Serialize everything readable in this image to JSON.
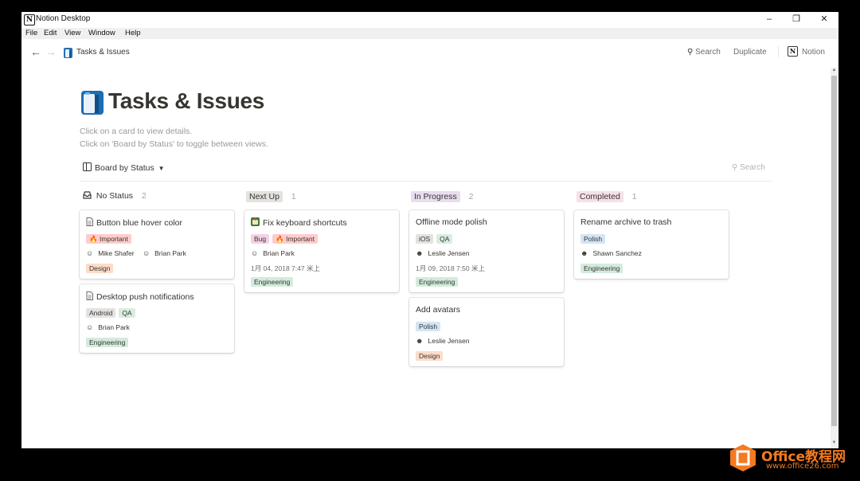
{
  "window": {
    "app_title": "Notion Desktop",
    "menus": [
      "File",
      "Edit",
      "View",
      "Window",
      "Help"
    ]
  },
  "topbar": {
    "breadcrumb": "Tasks & Issues",
    "actions": {
      "search": "Search",
      "duplicate": "Duplicate",
      "notion": "Notion"
    }
  },
  "page": {
    "title": "Tasks & Issues",
    "description": [
      "Click on a card to view details.",
      "Click on 'Board by Status' to toggle between views."
    ],
    "view_switcher": "Board by Status",
    "board_search": "Search"
  },
  "board": {
    "columns": [
      {
        "name": "No Status",
        "count": "2",
        "cards": [
          {
            "title": "Button blue hover color",
            "tags1": [
              {
                "label": "Important",
                "color": "#ffcccc",
                "emoji": "🔥"
              }
            ],
            "people": [
              "Mike Shafer",
              "Brian Park"
            ],
            "tags2": [
              {
                "label": "Design",
                "color": "#fcdcc8"
              }
            ]
          },
          {
            "title": "Desktop push notifications",
            "tags1": [
              {
                "label": "Android",
                "color": "#e3e2e0"
              },
              {
                "label": "QA",
                "color": "#d9ede0"
              }
            ],
            "people": [
              "Brian Park"
            ],
            "tags2": [
              {
                "label": "Engineering",
                "color": "#d3ebdd"
              }
            ]
          }
        ]
      },
      {
        "name": "Next Up",
        "count": "1",
        "cards": [
          {
            "title": "Fix keyboard shortcuts",
            "tags1": [
              {
                "label": "Bug",
                "color": "#f5d0e6"
              },
              {
                "label": "Important",
                "color": "#ffcccc",
                "emoji": "🔥"
              }
            ],
            "people": [
              "Brian Park"
            ],
            "date": "1月 04, 2018 7:47 米上",
            "tags2": [
              {
                "label": "Engineering",
                "color": "#d3ebdd"
              }
            ]
          }
        ]
      },
      {
        "name": "In Progress",
        "count": "2",
        "cards": [
          {
            "title": "Offline mode polish",
            "tags1": [
              {
                "label": "iOS",
                "color": "#e3e2e0"
              },
              {
                "label": "QA",
                "color": "#d9ede0"
              }
            ],
            "people": [
              "Leslie Jensen"
            ],
            "date": "1月 09, 2018 7:50 米上",
            "tags2": [
              {
                "label": "Engineering",
                "color": "#d3ebdd"
              }
            ]
          },
          {
            "title": "Add avatars",
            "tags1": [
              {
                "label": "Polish",
                "color": "#d3e5f5"
              }
            ],
            "people": [
              "Leslie Jensen"
            ],
            "tags2": [
              {
                "label": "Design",
                "color": "#fcdcc8"
              }
            ]
          }
        ]
      },
      {
        "name": "Completed",
        "count": "1",
        "cards": [
          {
            "title": "Rename archive to trash",
            "tags1": [
              {
                "label": "Polish",
                "color": "#d3e5f5"
              }
            ],
            "people": [
              "Shawn Sanchez"
            ],
            "tags2": [
              {
                "label": "Engineering",
                "color": "#d3ebdd"
              }
            ]
          }
        ]
      }
    ]
  },
  "watermark": {
    "brand": "Office教程网",
    "url": "www.office26.com"
  }
}
